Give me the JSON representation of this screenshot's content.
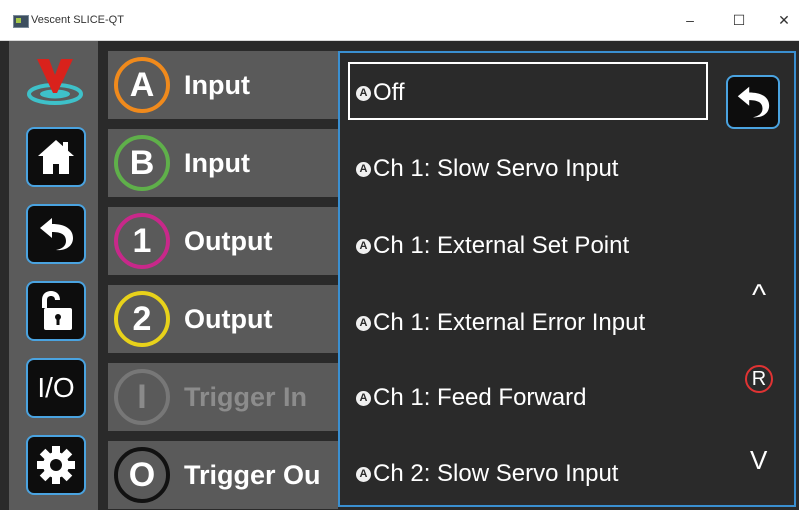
{
  "window": {
    "title": "Vescent SLICE-QT",
    "minimize": "–",
    "maximize": "☐",
    "close": "✕"
  },
  "sidebar": {
    "items": [
      {
        "name": "logo",
        "icon": "vescent-logo"
      },
      {
        "name": "home",
        "icon": "home-icon"
      },
      {
        "name": "back",
        "icon": "back-arrow-icon"
      },
      {
        "name": "lock",
        "icon": "unlock-icon"
      },
      {
        "name": "io",
        "label": "I/O"
      },
      {
        "name": "settings",
        "icon": "gear-icon"
      }
    ]
  },
  "rows": [
    {
      "badge": "A",
      "label": "Input",
      "ring_color": "#f08a1c"
    },
    {
      "badge": "B",
      "label": "Input",
      "ring_color": "#5fb04a"
    },
    {
      "badge": "1",
      "label": "Output",
      "ring_color": "#c8288a"
    },
    {
      "badge": "2",
      "label": "Output",
      "ring_color": "#e8d21a"
    },
    {
      "badge": "I",
      "label": "Trigger In",
      "ring_color": "#777777",
      "disabled": true
    },
    {
      "badge": "O",
      "label": "Trigger Ou",
      "ring_color": "#111111"
    }
  ],
  "dropdown": {
    "badge": "A",
    "options": [
      {
        "label": "Off",
        "selected": true
      },
      {
        "label": "Ch 1: Slow Servo Input"
      },
      {
        "label": "Ch 1: External Set Point"
      },
      {
        "label": "Ch 1: External Error Input"
      },
      {
        "label": "Ch 1: Feed Forward"
      },
      {
        "label": "Ch 2: Slow Servo Input"
      }
    ],
    "scroll_up": "^",
    "scroll_down": "V",
    "reset_badge": "R"
  },
  "colors": {
    "accent_blue": "#3a8fd0",
    "reset_red": "#e03333"
  }
}
